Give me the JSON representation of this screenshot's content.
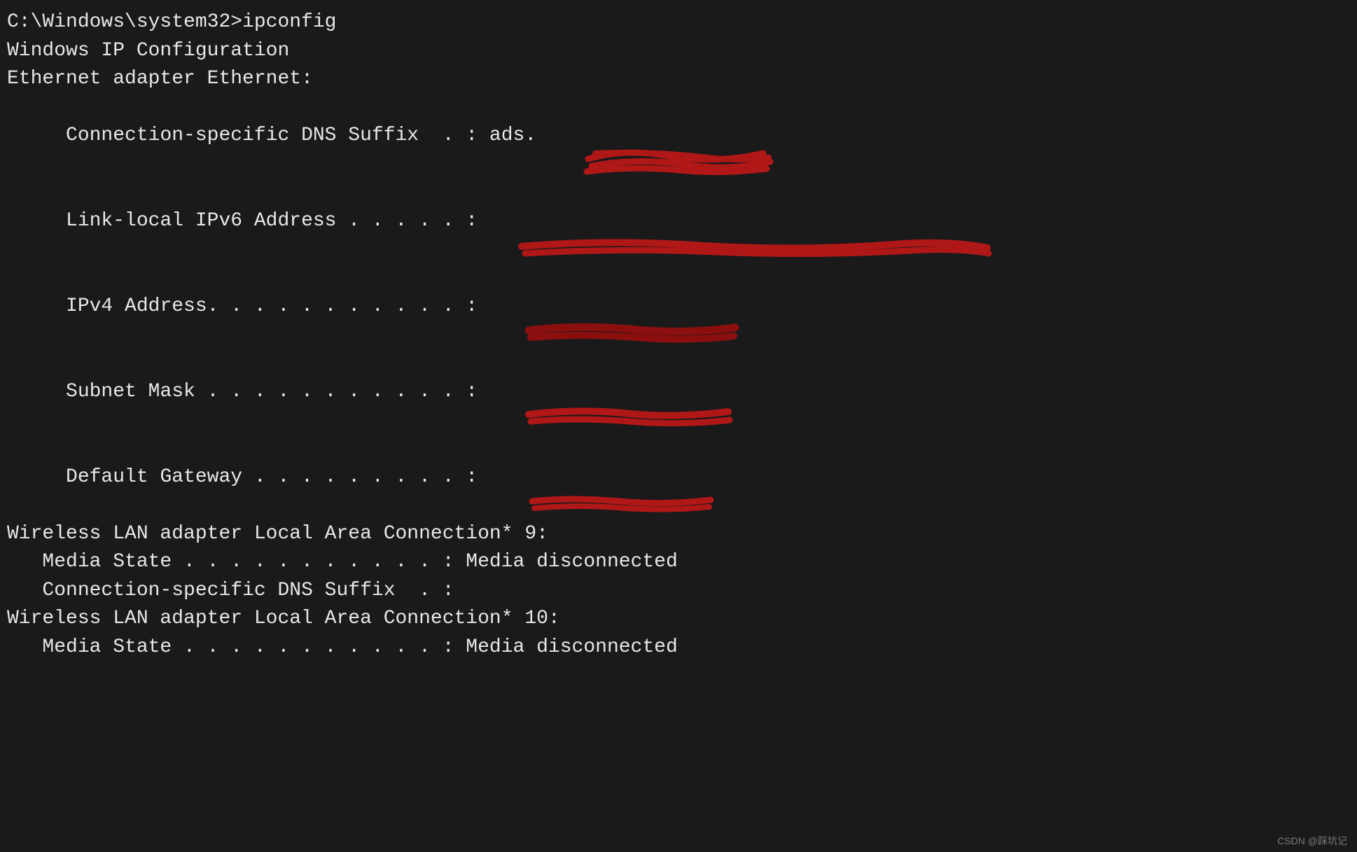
{
  "prompt": "C:\\Windows\\system32>ipconfig",
  "blank": "",
  "header": "Windows IP Configuration",
  "adapters": [
    {
      "title": "Ethernet adapter Ethernet:",
      "lines": [
        {
          "label": "   Connection-specific DNS Suffix  . : ads."
        },
        {
          "label": "   Link-local IPv6 Address . . . . . : "
        },
        {
          "label": "   IPv4 Address. . . . . . . . . . . : "
        },
        {
          "label": "   Subnet Mask . . . . . . . . . . . : "
        },
        {
          "label": "   Default Gateway . . . . . . . . . : "
        }
      ]
    },
    {
      "title": "Wireless LAN adapter Local Area Connection* 9:",
      "lines": [
        {
          "label": "   Media State . . . . . . . . . . . : Media disconnected"
        },
        {
          "label": "   Connection-specific DNS Suffix  . :"
        }
      ]
    },
    {
      "title": "Wireless LAN adapter Local Area Connection* 10:",
      "lines": [
        {
          "label": "   Media State . . . . . . . . . . . : Media disconnected"
        }
      ]
    }
  ],
  "watermark": "CSDN @踩坑记"
}
